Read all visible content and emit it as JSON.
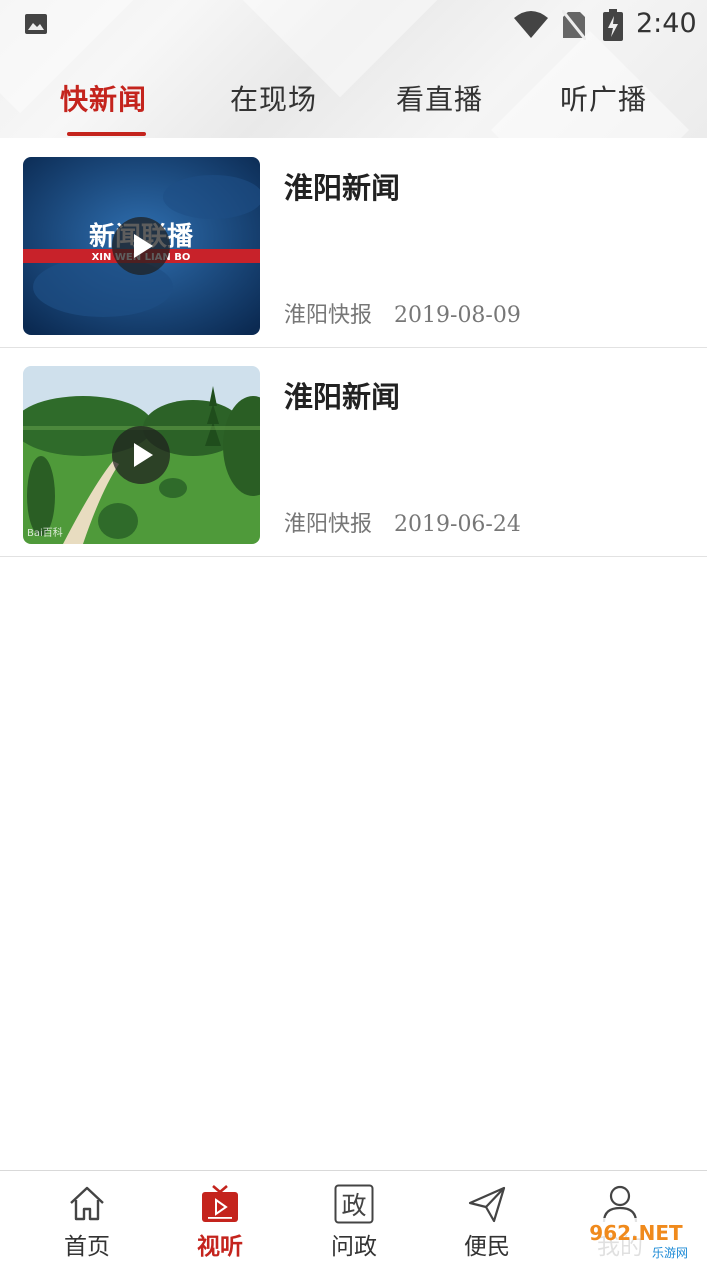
{
  "status_bar": {
    "time": "2:40",
    "icons": [
      "gallery-icon",
      "wifi-icon",
      "no-sim-icon",
      "battery-charging-icon"
    ]
  },
  "tabs": [
    {
      "label": "快新闻",
      "active": true
    },
    {
      "label": "在现场",
      "active": false
    },
    {
      "label": "看直播",
      "active": false
    },
    {
      "label": "听广播",
      "active": false
    }
  ],
  "news_items": [
    {
      "title": "淮阳新闻",
      "source": "淮阳快报",
      "date": "2019-08-09",
      "thumbnail_text": "新闻联播",
      "thumbnail_subtext": "XIN WEN LIAN BO"
    },
    {
      "title": "淮阳新闻",
      "source": "淮阳快报",
      "date": "2019-06-24",
      "thumbnail_text": "Bai百科"
    }
  ],
  "bottom_nav": [
    {
      "label": "首页",
      "icon": "home-icon",
      "active": false
    },
    {
      "label": "视听",
      "icon": "tv-play-icon",
      "active": true
    },
    {
      "label": "问政",
      "icon": "zheng-box-icon",
      "icon_char": "政",
      "active": false
    },
    {
      "label": "便民",
      "icon": "paper-plane-icon",
      "active": false
    },
    {
      "label": "我的",
      "icon": "user-icon",
      "active": false
    }
  ],
  "watermark": {
    "text": "962.NET",
    "subtext": "乐游网"
  },
  "colors": {
    "accent": "#c4241d",
    "text": "#222222",
    "meta": "#777777",
    "divider": "#e2e2e2"
  }
}
